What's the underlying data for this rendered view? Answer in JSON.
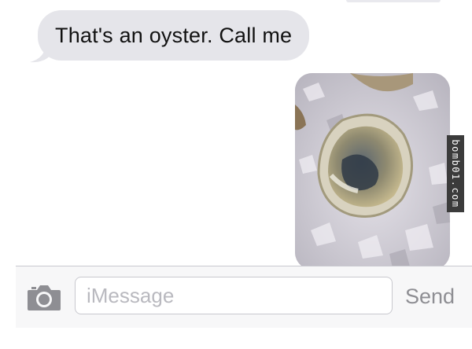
{
  "conversation": {
    "messages": [
      {
        "direction": "incoming",
        "type": "text",
        "text": "That's an oyster. Call me"
      },
      {
        "direction": "outgoing",
        "type": "image",
        "image_subject": "oyster-on-ice"
      }
    ]
  },
  "watermark": {
    "text": "bomb01.com"
  },
  "composer": {
    "camera_icon": "camera-icon",
    "placeholder": "iMessage",
    "value": "",
    "send_label": "Send"
  },
  "colors": {
    "incoming_bubble": "#e5e5ea",
    "composer_background": "#f7f7f8",
    "send_disabled": "#8e8e93",
    "placeholder": "#b9b9bf"
  }
}
